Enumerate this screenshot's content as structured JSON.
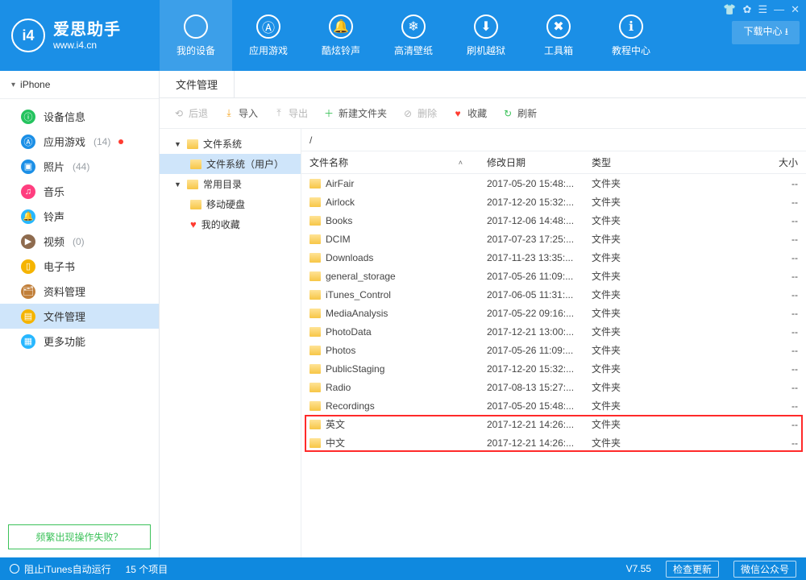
{
  "header": {
    "brand_cn": "爱思助手",
    "brand_url": "www.i4.cn",
    "download_center": "下载中心 ⭳",
    "nav": [
      {
        "label": "我的设备",
        "icon": ""
      },
      {
        "label": "应用游戏",
        "icon": "Ⓐ"
      },
      {
        "label": "酷炫铃声",
        "icon": "🔔"
      },
      {
        "label": "高清壁纸",
        "icon": "❄"
      },
      {
        "label": "刷机越狱",
        "icon": "⬇"
      },
      {
        "label": "工具箱",
        "icon": "✖"
      },
      {
        "label": "教程中心",
        "icon": "ℹ"
      }
    ],
    "sys": [
      "👕",
      "✿",
      "☰",
      "—",
      "✕"
    ]
  },
  "sidebar": {
    "device": "iPhone",
    "items": [
      {
        "label": "设备信息",
        "icon": "ⓘ",
        "color": "#24c35e"
      },
      {
        "label": "应用游戏",
        "icon": "Ⓐ",
        "color": "#1b8fe6",
        "count": "(14)",
        "dot": true
      },
      {
        "label": "照片",
        "icon": "▣",
        "color": "#1b8fe6",
        "count": "(44)"
      },
      {
        "label": "音乐",
        "icon": "♫",
        "color": "#ff3e7f"
      },
      {
        "label": "铃声",
        "icon": "🔔",
        "color": "#27b7ff"
      },
      {
        "label": "视频",
        "icon": "▶",
        "color": "#8e6b4e",
        "count": "(0)"
      },
      {
        "label": "电子书",
        "icon": "▯",
        "color": "#f5b400"
      },
      {
        "label": "资料管理",
        "icon": "🗂",
        "color": "#c17f3a"
      },
      {
        "label": "文件管理",
        "icon": "▤",
        "color": "#f5b400",
        "active": true
      },
      {
        "label": "更多功能",
        "icon": "▦",
        "color": "#27b7ff"
      }
    ],
    "banner": "频繁出现操作失败？"
  },
  "content": {
    "tab": "文件管理",
    "toolbar": {
      "back": "后退",
      "import": "导入",
      "export": "导出",
      "new_folder": "新建文件夹",
      "delete": "删除",
      "favorite": "收藏",
      "refresh": "刷新"
    },
    "tree": {
      "root": "文件系统",
      "user_fs": "文件系统（用户）",
      "common_dir": "常用目录",
      "mobile_hdd": "移动硬盘",
      "my_fav": "我的收藏"
    },
    "path": "/",
    "columns": {
      "name": "文件名称",
      "date": "修改日期",
      "type": "类型",
      "size": "大小"
    },
    "files": [
      {
        "name": "AirFair",
        "date": "2017-05-20 15:48:...",
        "type": "文件夹",
        "size": "--"
      },
      {
        "name": "Airlock",
        "date": "2017-12-20 15:32:...",
        "type": "文件夹",
        "size": "--"
      },
      {
        "name": "Books",
        "date": "2017-12-06 14:48:...",
        "type": "文件夹",
        "size": "--"
      },
      {
        "name": "DCIM",
        "date": "2017-07-23 17:25:...",
        "type": "文件夹",
        "size": "--"
      },
      {
        "name": "Downloads",
        "date": "2017-11-23 13:35:...",
        "type": "文件夹",
        "size": "--"
      },
      {
        "name": "general_storage",
        "date": "2017-05-26 11:09:...",
        "type": "文件夹",
        "size": "--"
      },
      {
        "name": "iTunes_Control",
        "date": "2017-06-05 11:31:...",
        "type": "文件夹",
        "size": "--"
      },
      {
        "name": "MediaAnalysis",
        "date": "2017-05-22 09:16:...",
        "type": "文件夹",
        "size": "--"
      },
      {
        "name": "PhotoData",
        "date": "2017-12-21 13:00:...",
        "type": "文件夹",
        "size": "--"
      },
      {
        "name": "Photos",
        "date": "2017-05-26 11:09:...",
        "type": "文件夹",
        "size": "--"
      },
      {
        "name": "PublicStaging",
        "date": "2017-12-20 15:32:...",
        "type": "文件夹",
        "size": "--"
      },
      {
        "name": "Radio",
        "date": "2017-08-13 15:27:...",
        "type": "文件夹",
        "size": "--"
      },
      {
        "name": "Recordings",
        "date": "2017-05-20 15:48:...",
        "type": "文件夹",
        "size": "--"
      },
      {
        "name": "英文",
        "date": "2017-12-21 14:26:...",
        "type": "文件夹",
        "size": "--"
      },
      {
        "name": "中文",
        "date": "2017-12-21 14:26:...",
        "type": "文件夹",
        "size": "--"
      }
    ],
    "highlight_rows": [
      13,
      14
    ]
  },
  "status": {
    "itunes": "阻止iTunes自动运行",
    "item_count": "15 个项目",
    "version": "V7.55",
    "check_update": "检查更新",
    "wechat": "微信公众号"
  }
}
